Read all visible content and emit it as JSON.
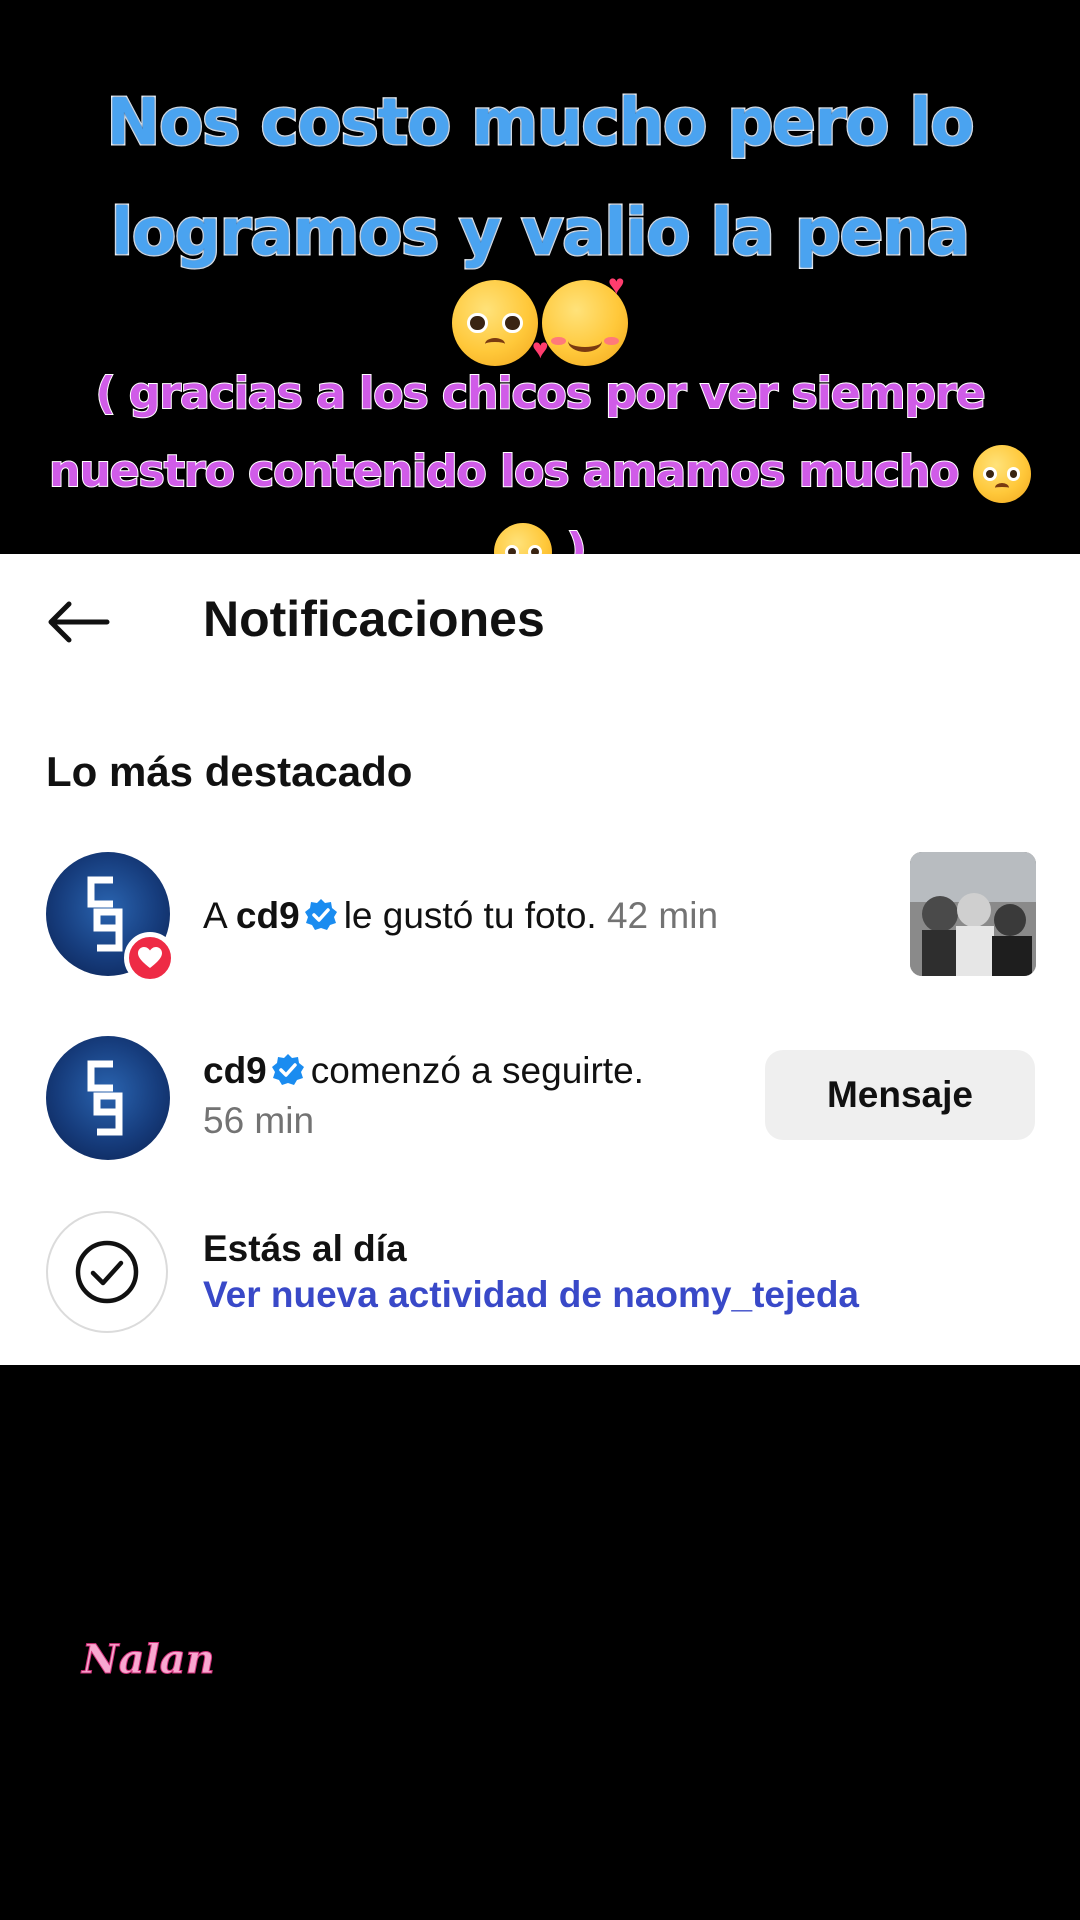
{
  "overlay": {
    "caption_line1": "Nos costo mucho pero lo",
    "caption_line2": "logramos y valio la pena",
    "caption_emojis": [
      "pleading-face-emoji",
      "smiling-face-with-hearts-emoji"
    ],
    "sub_line1": "( gracias a los chicos por ver siempre",
    "sub_line2": "nuestro contenido los amamos mucho",
    "sub_line2_emoji": "pleading-face-emoji",
    "sub_line3_emoji": "face-holding-back-tears-emoji",
    "sub_line3_close": ")",
    "watermark": "Nalan",
    "colors": {
      "caption": "#4aa3f0",
      "subcaption": "#d05ce8",
      "watermark": "#f8a8d0"
    }
  },
  "header": {
    "back_icon": "arrow-left-icon",
    "title": "Notificaciones"
  },
  "section": {
    "title": "Lo más destacado"
  },
  "notifications": [
    {
      "avatar_text": "cd9",
      "badge_icon": "heart-icon",
      "prefix": "A",
      "username": "cd9",
      "verified_icon": "verified-badge-icon",
      "action": "le gustó tu foto.",
      "time": "42 min",
      "thumbnail": "photo-thumbnail"
    },
    {
      "avatar_text": "cd9",
      "username": "cd9",
      "verified_icon": "verified-badge-icon",
      "action": "comenzó a seguirte.",
      "time": "56 min",
      "button_label": "Mensaje"
    }
  ],
  "caught_up": {
    "icon": "check-circle-icon",
    "title": "Estás al día",
    "link": "Ver nueva actividad de naomy_tejeda"
  },
  "theme": {
    "link_color": "#3949c8",
    "like_badge_color": "#ee2b45",
    "verified_color": "#1a8cf0"
  }
}
